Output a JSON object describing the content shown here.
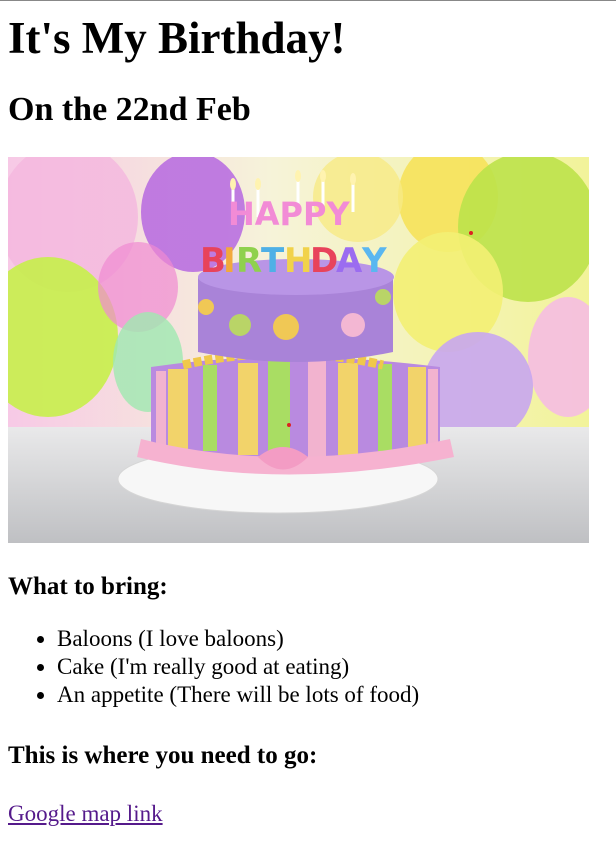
{
  "page": {
    "title": "It's My Birthday!",
    "subtitle": "On the 22nd Feb",
    "image_alt": "birthday cake",
    "cake_text": "HAPPY BIRTHDAY",
    "bring_heading": "What to bring:",
    "bring_items": [
      "Baloons (I love baloons)",
      "Cake (I'm really good at eating)",
      "An appetite (There will be lots of food)"
    ],
    "where_heading": "This is where you need to go:",
    "map_link": "Google map link"
  },
  "colors": {
    "link_visited": "#551a8b",
    "text": "#000000"
  }
}
